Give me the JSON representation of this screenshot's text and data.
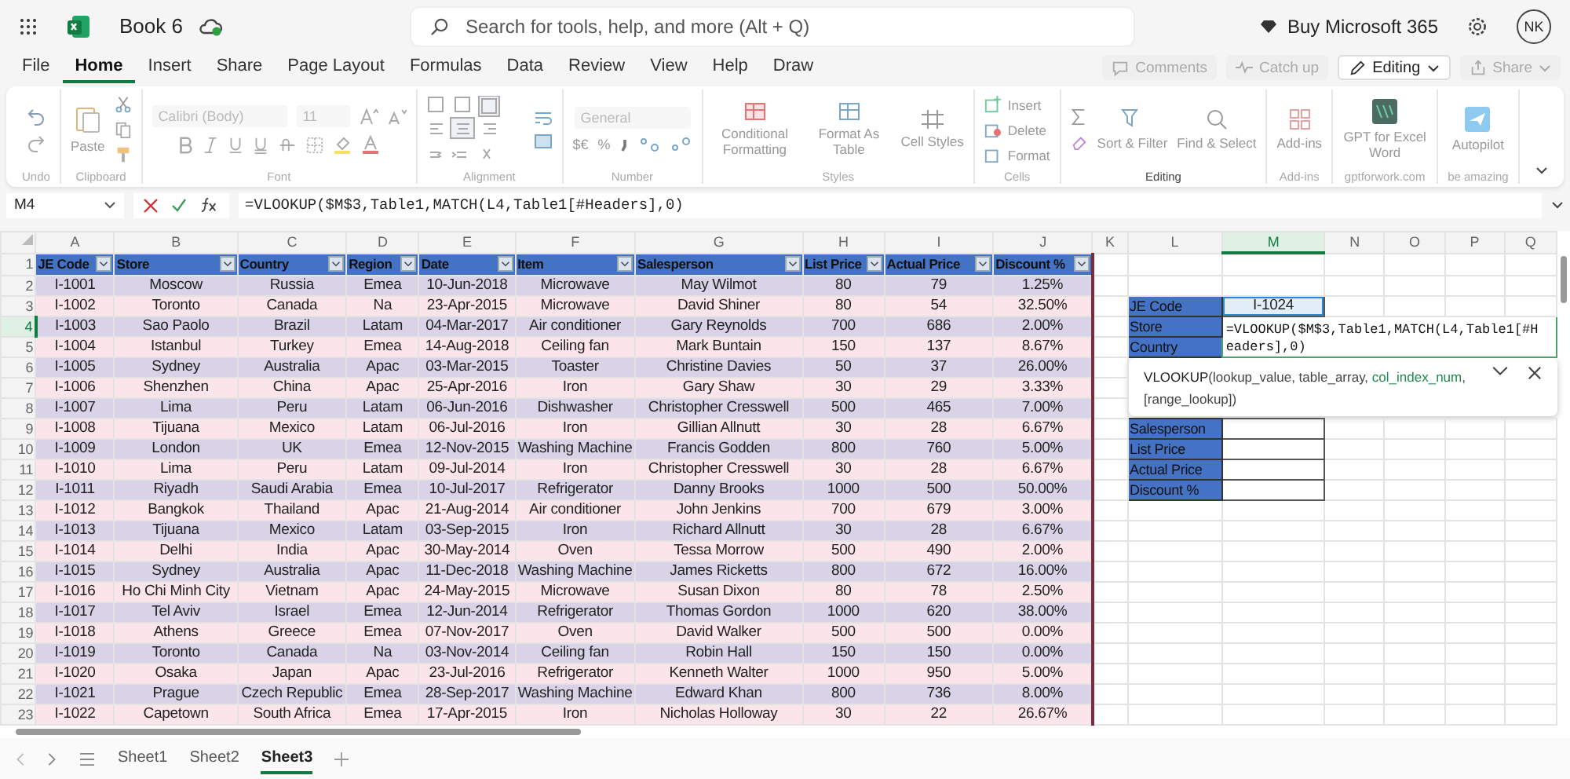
{
  "app": {
    "title": "Book 6",
    "search_placeholder": "Search for tools, help, and more (Alt + Q)",
    "buy_label": "Buy Microsoft 365",
    "avatar_initials": "NK"
  },
  "menu_tabs": [
    {
      "label": "File",
      "selected": false
    },
    {
      "label": "Home",
      "selected": true
    },
    {
      "label": "Insert",
      "selected": false
    },
    {
      "label": "Share",
      "selected": false
    },
    {
      "label": "Page Layout",
      "selected": false
    },
    {
      "label": "Formulas",
      "selected": false
    },
    {
      "label": "Data",
      "selected": false
    },
    {
      "label": "Review",
      "selected": false
    },
    {
      "label": "View",
      "selected": false
    },
    {
      "label": "Help",
      "selected": false
    },
    {
      "label": "Draw",
      "selected": false
    }
  ],
  "menu_actions": [
    {
      "kind": "comments",
      "label": "Comments"
    },
    {
      "kind": "catchup",
      "label": "Catch up"
    },
    {
      "kind": "editing",
      "label": "Editing"
    },
    {
      "kind": "share",
      "label": "Share"
    }
  ],
  "ribbon": [
    {
      "kind": "undo",
      "label": "Undo"
    },
    {
      "kind": "clipboard",
      "label": "Clipboard",
      "items": [
        "Paste"
      ]
    },
    {
      "kind": "font",
      "label": "Font",
      "items": [
        "Calibri (Body)",
        "11"
      ]
    },
    {
      "kind": "alignment",
      "label": "Alignment"
    },
    {
      "kind": "number",
      "label": "Number",
      "items": [
        "General",
        "$€",
        "%"
      ]
    },
    {
      "kind": "styles",
      "label": "Styles",
      "items": [
        "Conditional Formatting",
        "Format As Table",
        "Cell Styles"
      ]
    },
    {
      "kind": "cells",
      "label": "Cells",
      "items": [
        "Insert",
        "Delete",
        "Format"
      ]
    },
    {
      "kind": "editing",
      "label": "Editing",
      "items": [
        "Sort & Filter",
        "Find & Select"
      ]
    },
    {
      "kind": "addins",
      "label": "Add-ins",
      "items": [
        "Add-ins"
      ]
    },
    {
      "kind": "gpt",
      "label": "gptforwork.com",
      "items": [
        "GPT for Excel Word"
      ]
    },
    {
      "kind": "autopilot",
      "label": "be amazing",
      "items": [
        "Autopilot"
      ]
    }
  ],
  "formula_bar": {
    "name_box": "M4",
    "formula": "=VLOOKUP($M$3,Table1,MATCH(L4,Table1[#Headers],0)"
  },
  "grid": {
    "columns": [
      {
        "label": "A",
        "selected": false
      },
      {
        "label": "B",
        "selected": false
      },
      {
        "label": "C",
        "selected": false
      },
      {
        "label": "D",
        "selected": false
      },
      {
        "label": "E",
        "selected": false
      },
      {
        "label": "F",
        "selected": false
      },
      {
        "label": "G",
        "selected": false
      },
      {
        "label": "H",
        "selected": false
      },
      {
        "label": "I",
        "selected": false
      },
      {
        "label": "J",
        "selected": false
      },
      {
        "label": "K",
        "selected": false
      },
      {
        "label": "L",
        "selected": false
      },
      {
        "label": "M",
        "selected": true
      },
      {
        "label": "N",
        "selected": false
      },
      {
        "label": "O",
        "selected": false
      },
      {
        "label": "P",
        "selected": false
      },
      {
        "label": "Q",
        "selected": false
      }
    ],
    "rows": [
      {
        "label": "1",
        "selected": false
      },
      {
        "label": "2",
        "selected": false
      },
      {
        "label": "3",
        "selected": false
      },
      {
        "label": "4",
        "selected": true
      },
      {
        "label": "5",
        "selected": false
      },
      {
        "label": "6",
        "selected": false
      },
      {
        "label": "7",
        "selected": false
      },
      {
        "label": "8",
        "selected": false
      },
      {
        "label": "9",
        "selected": false
      },
      {
        "label": "10",
        "selected": false
      },
      {
        "label": "11",
        "selected": false
      },
      {
        "label": "12",
        "selected": false
      },
      {
        "label": "13",
        "selected": false
      },
      {
        "label": "14",
        "selected": false
      },
      {
        "label": "15",
        "selected": false
      },
      {
        "label": "16",
        "selected": false
      },
      {
        "label": "17",
        "selected": false
      },
      {
        "label": "18",
        "selected": false
      },
      {
        "label": "19",
        "selected": false
      },
      {
        "label": "20",
        "selected": false
      },
      {
        "label": "21",
        "selected": false
      },
      {
        "label": "22",
        "selected": false
      },
      {
        "label": "23",
        "selected": false
      }
    ]
  },
  "table": {
    "columns": [
      "JE Code",
      "Store",
      "Country",
      "Region",
      "Date",
      "Item",
      "Salesperson",
      "List Price",
      "Actual Price",
      "Discount %"
    ],
    "rows": [
      [
        "I-1001",
        "Moscow",
        "Russia",
        "Emea",
        "10-Jun-2018",
        "Microwave",
        "May Wilmot",
        "80",
        "79",
        "1.25%"
      ],
      [
        "I-1002",
        "Toronto",
        "Canada",
        "Na",
        "23-Apr-2015",
        "Microwave",
        "David Shiner",
        "80",
        "54",
        "32.50%"
      ],
      [
        "I-1003",
        "Sao Paolo",
        "Brazil",
        "Latam",
        "04-Mar-2017",
        "Air conditioner",
        "Gary Reynolds",
        "700",
        "686",
        "2.00%"
      ],
      [
        "I-1004",
        "Istanbul",
        "Turkey",
        "Emea",
        "14-Aug-2018",
        "Ceiling fan",
        "Mark Buntain",
        "150",
        "137",
        "8.67%"
      ],
      [
        "I-1005",
        "Sydney",
        "Australia",
        "Apac",
        "03-Mar-2015",
        "Toaster",
        "Christine Davies",
        "50",
        "37",
        "26.00%"
      ],
      [
        "I-1006",
        "Shenzhen",
        "China",
        "Apac",
        "25-Apr-2016",
        "Iron",
        "Gary Shaw",
        "30",
        "29",
        "3.33%"
      ],
      [
        "I-1007",
        "Lima",
        "Peru",
        "Latam",
        "06-Jun-2016",
        "Dishwasher",
        "Christopher Cresswell",
        "500",
        "465",
        "7.00%"
      ],
      [
        "I-1008",
        "Tijuana",
        "Mexico",
        "Latam",
        "06-Jul-2016",
        "Iron",
        "Gillian Allnutt",
        "30",
        "28",
        "6.67%"
      ],
      [
        "I-1009",
        "London",
        "UK",
        "Emea",
        "12-Nov-2015",
        "Washing Machine",
        "Francis Godden",
        "800",
        "760",
        "5.00%"
      ],
      [
        "I-1010",
        "Lima",
        "Peru",
        "Latam",
        "09-Jul-2014",
        "Iron",
        "Christopher Cresswell",
        "30",
        "28",
        "6.67%"
      ],
      [
        "I-1011",
        "Riyadh",
        "Saudi Arabia",
        "Emea",
        "10-Jul-2017",
        "Refrigerator",
        "Danny Brooks",
        "1000",
        "500",
        "50.00%"
      ],
      [
        "I-1012",
        "Bangkok",
        "Thailand",
        "Apac",
        "21-Aug-2014",
        "Air conditioner",
        "John Jenkins",
        "700",
        "679",
        "3.00%"
      ],
      [
        "I-1013",
        "Tijuana",
        "Mexico",
        "Latam",
        "03-Sep-2015",
        "Iron",
        "Richard Allnutt",
        "30",
        "28",
        "6.67%"
      ],
      [
        "I-1014",
        "Delhi",
        "India",
        "Apac",
        "30-May-2014",
        "Oven",
        "Tessa Morrow",
        "500",
        "490",
        "2.00%"
      ],
      [
        "I-1015",
        "Sydney",
        "Australia",
        "Apac",
        "11-Dec-2018",
        "Washing Machine",
        "James Ricketts",
        "800",
        "672",
        "16.00%"
      ],
      [
        "I-1016",
        "Ho Chi Minh City",
        "Vietnam",
        "Apac",
        "24-May-2015",
        "Microwave",
        "Susan Dixon",
        "80",
        "78",
        "2.50%"
      ],
      [
        "I-1017",
        "Tel Aviv",
        "Israel",
        "Emea",
        "12-Jun-2014",
        "Refrigerator",
        "Thomas Gordon",
        "1000",
        "620",
        "38.00%"
      ],
      [
        "I-1018",
        "Athens",
        "Greece",
        "Emea",
        "07-Nov-2017",
        "Oven",
        "David Walker",
        "500",
        "500",
        "0.00%"
      ],
      [
        "I-1019",
        "Toronto",
        "Canada",
        "Na",
        "03-Nov-2014",
        "Ceiling fan",
        "Robin Hall",
        "150",
        "150",
        "0.00%"
      ],
      [
        "I-1020",
        "Osaka",
        "Japan",
        "Apac",
        "23-Jul-2016",
        "Refrigerator",
        "Kenneth Walter",
        "1000",
        "950",
        "5.00%"
      ],
      [
        "I-1021",
        "Prague",
        "Czech Republic",
        "Emea",
        "28-Sep-2017",
        "Washing Machine",
        "Edward Khan",
        "800",
        "736",
        "8.00%"
      ],
      [
        "I-1022",
        "Capetown",
        "South Africa",
        "Emea",
        "17-Apr-2015",
        "Iron",
        "Nicholas Holloway",
        "30",
        "22",
        "26.67%"
      ]
    ]
  },
  "lookup": {
    "rows": [
      {
        "kind": "field",
        "label": "JE Code",
        "value": "I-1024"
      },
      {
        "kind": "field",
        "label": "Store"
      },
      {
        "kind": "field",
        "label": "Country"
      },
      {
        "kind": "covered"
      },
      {
        "kind": "covered"
      },
      {
        "kind": "covered"
      },
      {
        "kind": "field",
        "label": "Salesperson"
      },
      {
        "kind": "field",
        "label": "List Price"
      },
      {
        "kind": "field",
        "label": "Actual Price"
      },
      {
        "kind": "field",
        "label": "Discount %"
      }
    ]
  },
  "cell_editor": {
    "text": "=VLOOKUP($M$3,Table1,MATCH(L4,Table1[#Headers],0)"
  },
  "tooltip": {
    "signature": "**VLOOKUP**(lookup_value, table_array, *col_index_num*, [range_lookup])"
  },
  "sheets": [
    {
      "label": "Sheet1",
      "selected": false
    },
    {
      "label": "Sheet2",
      "selected": false
    },
    {
      "label": "Sheet3",
      "selected": true
    }
  ]
}
